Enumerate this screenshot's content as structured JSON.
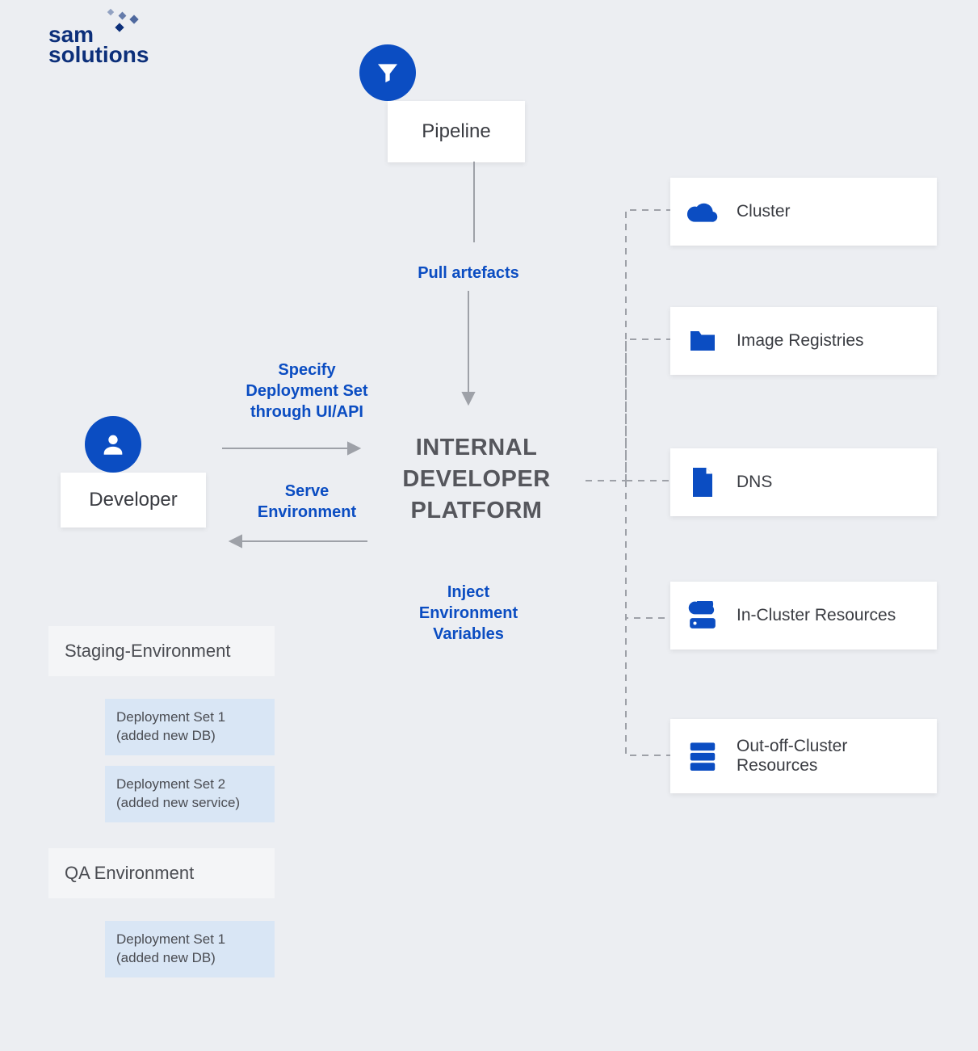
{
  "logo": {
    "line1": "sam",
    "line2": "solutions"
  },
  "nodes": {
    "pipeline": "Pipeline",
    "developer": "Developer",
    "center": "INTERNAL DEVELOPER PLATFORM"
  },
  "flows": {
    "pull": "Pull artefacts",
    "specify": "Specify Deployment Set through UI/API",
    "serve": "Serve Environment",
    "inject": "Inject Environment Variables"
  },
  "resources": [
    {
      "label": "Cluster",
      "icon": "cloud"
    },
    {
      "label": "Image Registries",
      "icon": "folder"
    },
    {
      "label": "DNS",
      "icon": "file"
    },
    {
      "label": "In-Cluster Resources",
      "icon": "cloud-stack"
    },
    {
      "label": "Out-off-Cluster Resources",
      "icon": "db"
    }
  ],
  "environments": [
    {
      "name": "Staging-Environment",
      "deployments": [
        "Deployment Set 1 (added new DB)",
        "Deployment Set 2 (added new service)"
      ]
    },
    {
      "name": "QA Environment",
      "deployments": [
        "Deployment Set 1 (added new DB)"
      ]
    }
  ]
}
